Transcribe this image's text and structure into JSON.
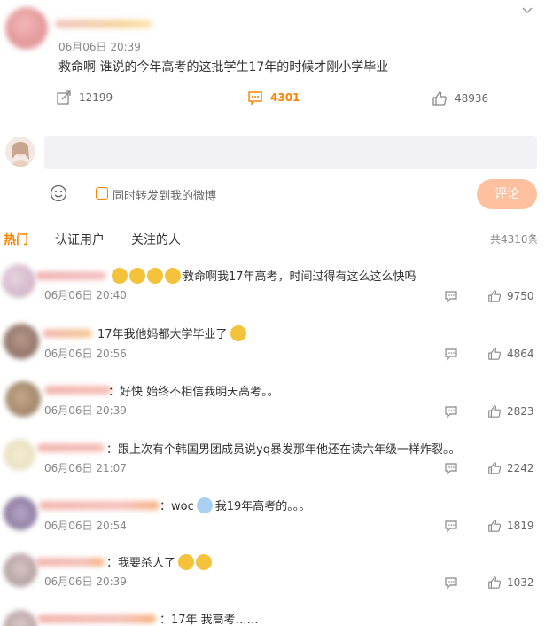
{
  "post": {
    "time": "06月06日 20:39",
    "text": "救命啊 谁说的今年高考的这批学生17年的时候才刚小学毕业",
    "repost_count": "12199",
    "comment_count": "4301",
    "like_count": "48936"
  },
  "composer": {
    "placeholder": "",
    "forward_label": "同时转发到我的微博",
    "submit_label": "评论"
  },
  "tabs": {
    "hot": "热门",
    "verified": "认证用户",
    "following": "关注的人",
    "total": "共4310条"
  },
  "comments": [
    {
      "text": "救命啊我17年高考，时间过得有这么这么快吗",
      "time": "06月06日 20:40",
      "likes": "9750"
    },
    {
      "text": "17年我他妈都大学毕业了",
      "time": "06月06日 20:56",
      "likes": "4864"
    },
    {
      "text": "：好快 始终不相信我明天高考。。",
      "time": "06月06日 20:39",
      "likes": "2823"
    },
    {
      "text": "：跟上次有个韩国男团成员说yq暴发那年他还在读六年级一样炸裂。。",
      "time": "06月06日 21:07",
      "likes": "2242"
    },
    {
      "text_a": "：woc",
      "text_b": "我19年高考的。。。",
      "time": "06月06日 20:54",
      "likes": "1819"
    },
    {
      "text": "：我要杀人了",
      "time": "06月06日 20:39",
      "likes": "1032"
    },
    {
      "text": "：17年 我高考……"
    }
  ],
  "colors": {
    "accent": "#ff8200",
    "submit_bg": "#ffc09f",
    "input_bg": "#f2f2f5"
  }
}
